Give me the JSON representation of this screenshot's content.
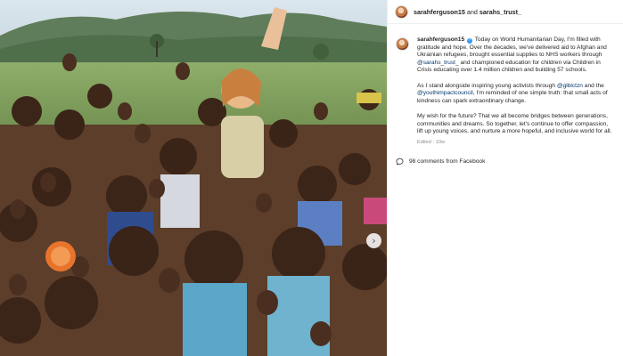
{
  "header": {
    "user_primary": "sarahferguson15",
    "and_text": " and ",
    "user_secondary": "sarahs_trust_"
  },
  "post": {
    "author": "sarahferguson15",
    "paragraphs": [
      {
        "before": " Today on World Humanitarian Day, I'm filled with gratitude and hope. Over the decades, we've delivered aid to Afghan and Ukrainian refugees, brought essential supplies to NHS workers through ",
        "mention": "@sarahs_trust_",
        "after": " and championed education for children via Children in Crisis educating over 1.4 million children and building 57 schools."
      },
      {
        "before": "As I stand alongside inspiring young activists through ",
        "mention1": "@glblctzn",
        "middle": " and the ",
        "mention2": "@youthimpactcouncil",
        "after": ", I'm reminded of one simple truth: that small acts of kindness can spark extraordinary change."
      },
      {
        "text": "My wish for the future? That we all become bridges between generations, communities and dreams. So together, let's continue to offer compassion, lift up young voices, and nurture a more hopeful, and inclusive world for all."
      }
    ],
    "meta": "Edited · 10w",
    "comments": "98 comments from Facebook"
  },
  "icons": {
    "avatar": "profile-photo",
    "verified": "verified-badge-icon",
    "comment": "speech-bubble-icon",
    "next": "chevron-right-icon"
  },
  "colors": {
    "mention": "#00376b",
    "verified": "#3897f0",
    "meta": "#8e8e8e",
    "text": "#262626"
  }
}
